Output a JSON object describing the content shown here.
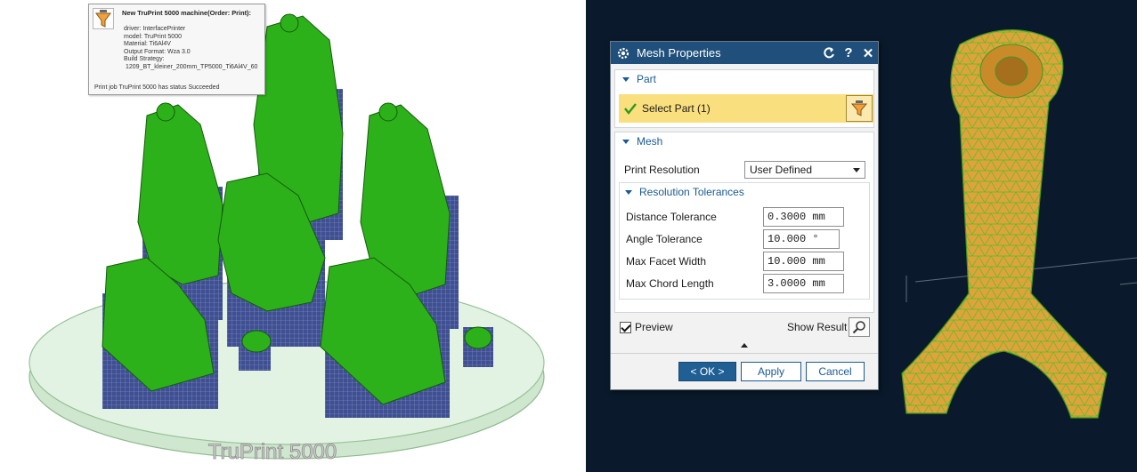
{
  "left_render": {
    "tooltip": {
      "title": "New TruPrint 5000 machine(Order: Print):",
      "lines": [
        "driver: InterfacePrinter",
        "model: TruPrint 5000",
        "Material: Ti6Al4V",
        "Output Format: Wza 3.0",
        "Build Strategy:",
        "1209_BT_kleiner_200mm_TP5000_Ti6Al4V_60"
      ],
      "footer": "Print job TruPrint 5000 has status Succeeded",
      "icon": "printer-funnel-icon"
    },
    "plate_label": "TruPrint 5000",
    "colors": {
      "part": "#2db11b",
      "support": "#3d4d8f",
      "plate": "#d9efd9"
    }
  },
  "dialog": {
    "title": "Mesh Properties",
    "title_icon": "gear-icon",
    "title_buttons": [
      "reset-icon",
      "help-icon",
      "close-icon"
    ],
    "part_group": {
      "label": "Part",
      "select_label": "Select Part (1)",
      "select_icon": "check-icon",
      "filter_icon": "funnel-icon"
    },
    "mesh_group": {
      "label": "Mesh",
      "print_resolution_label": "Print Resolution",
      "print_resolution_value": "User Defined",
      "tolerances": {
        "label": "Resolution Tolerances",
        "rows": [
          {
            "label": "Distance Tolerance",
            "value": "0.3000 mm"
          },
          {
            "label": "Angle Tolerance",
            "value": "10.000 °"
          },
          {
            "label": "Max Facet Width",
            "value": "10.000 mm"
          },
          {
            "label": "Max Chord Length",
            "value": "3.0000 mm"
          }
        ]
      }
    },
    "preview_label": "Preview",
    "show_result_label": "Show Result",
    "buttons": {
      "ok": "< OK >",
      "apply": "Apply",
      "cancel": "Cancel"
    },
    "colors": {
      "titlebar": "#1f4f7a",
      "selection": "#fadf7e",
      "accent": "#1b5a93"
    }
  },
  "right_render": {
    "colors": {
      "background": "#0a1a2c",
      "mesh_fill": "#e0a23a",
      "mesh_lines": "#4fc22a"
    }
  }
}
